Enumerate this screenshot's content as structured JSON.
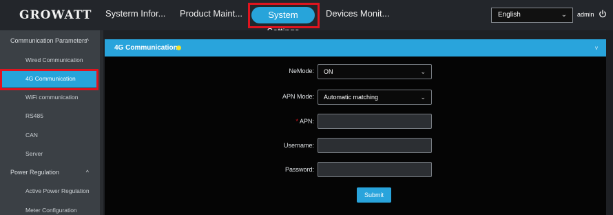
{
  "header": {
    "logo": "GROWATT",
    "nav": [
      {
        "label": "Systerm Infor..."
      },
      {
        "label": "Product Maint..."
      },
      {
        "label": "System Settings"
      },
      {
        "label": "Devices Monit..."
      }
    ],
    "language": "English",
    "user": "admin"
  },
  "sidebar": {
    "groups": [
      {
        "label": "Communication Parameters",
        "caret": "^"
      },
      {
        "label": "Power Regulation",
        "caret": "^"
      }
    ],
    "items": [
      {
        "label": "Wired Communication"
      },
      {
        "label": "4G Communication"
      },
      {
        "label": "WiFi communication"
      },
      {
        "label": "RS485"
      },
      {
        "label": "CAN"
      },
      {
        "label": "Server"
      },
      {
        "label": "Active Power Regulation"
      },
      {
        "label": "Meter Configuration"
      }
    ]
  },
  "card": {
    "title": "4G Communication",
    "caret": "v"
  },
  "form": {
    "nemode_label": "NeMode:",
    "nemode_value": "ON",
    "apn_mode_label": "APN Mode:",
    "apn_mode_value": "Automatic matching",
    "apn_required": "*",
    "apn_label": "APN:",
    "apn_value": "",
    "username_label": "Username:",
    "username_value": "",
    "password_label": "Password:",
    "password_value": "",
    "submit_label": "Submit"
  },
  "colors": {
    "accent": "#27a4da",
    "highlight": "#e0141f",
    "status_dot": "#f4e22b"
  }
}
